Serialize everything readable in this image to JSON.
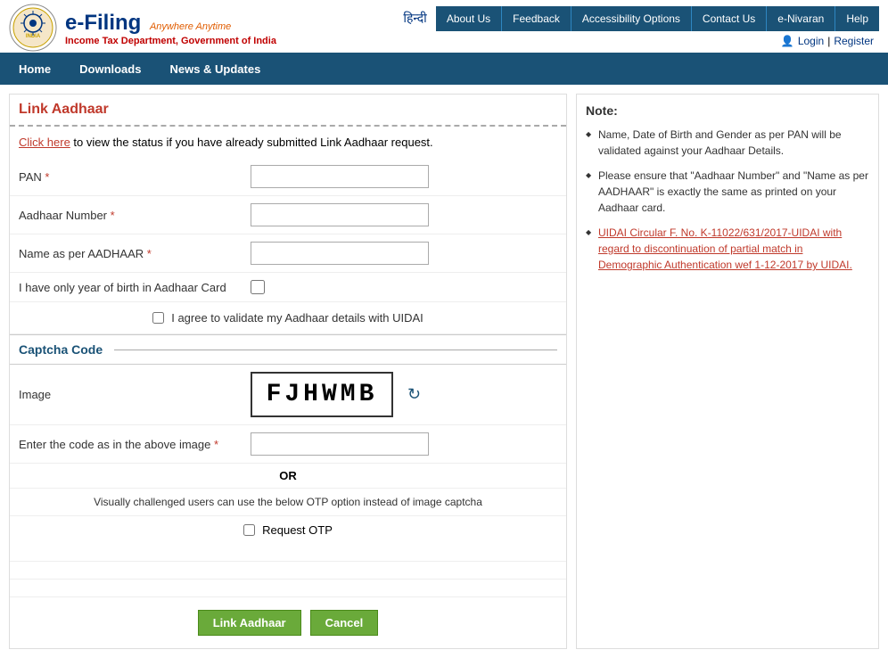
{
  "header": {
    "efiling_title": "e-Filing",
    "efiling_subtitle": "Anywhere Anytime",
    "income_tax_text": "Income Tax Department, Government of India",
    "hindi_label": "हिन्दी",
    "top_nav": [
      {
        "label": "About Us",
        "active": false
      },
      {
        "label": "Feedback",
        "active": false
      },
      {
        "label": "Accessibility Options",
        "active": false
      },
      {
        "label": "Contact Us",
        "active": false
      },
      {
        "label": "e-Nivaran",
        "active": false
      },
      {
        "label": "Help",
        "active": false
      }
    ],
    "login_label": "Login",
    "register_label": "Register"
  },
  "main_nav": [
    {
      "label": "Home"
    },
    {
      "label": "Downloads"
    },
    {
      "label": "News & Updates"
    }
  ],
  "form": {
    "title": "Link Aadhaar",
    "click_here_text": "Click here",
    "click_here_suffix": " to view the status if you have already submitted Link Aadhaar request.",
    "pan_label": "PAN",
    "pan_required": "*",
    "aadhaar_number_label": "Aadhaar Number",
    "aadhaar_number_required": "*",
    "name_aadhaar_label": "Name as per AADHAAR",
    "name_aadhaar_required": "*",
    "year_of_birth_label": "I have only year of birth in Aadhaar Card",
    "agree_label": "I agree to validate my Aadhaar details with UIDAI",
    "captcha_section_title": "Captcha Code",
    "image_label": "Image",
    "captcha_text": "FJHWMB",
    "enter_code_label": "Enter the code as in the above image",
    "enter_code_required": "*",
    "or_label": "OR",
    "otp_description": "Visually challenged users can use the below OTP option instead of image captcha",
    "request_otp_label": "Request OTP",
    "link_aadhaar_button": "Link Aadhaar",
    "cancel_button": "Cancel"
  },
  "note": {
    "title": "Note:",
    "items": [
      "Name, Date of Birth and Gender as per PAN will be validated against your Aadhaar Details.",
      "Please ensure that \"Aadhaar Number\" and \"Name as per AADHAAR\" is exactly the same as printed on your Aadhaar card.",
      "UIDAI Circular F. No. K-11022/631/2017-UIDAI with regard to discontinuation of partial match in Demographic Authentication wef 1-12-2017 by UIDAI."
    ]
  }
}
